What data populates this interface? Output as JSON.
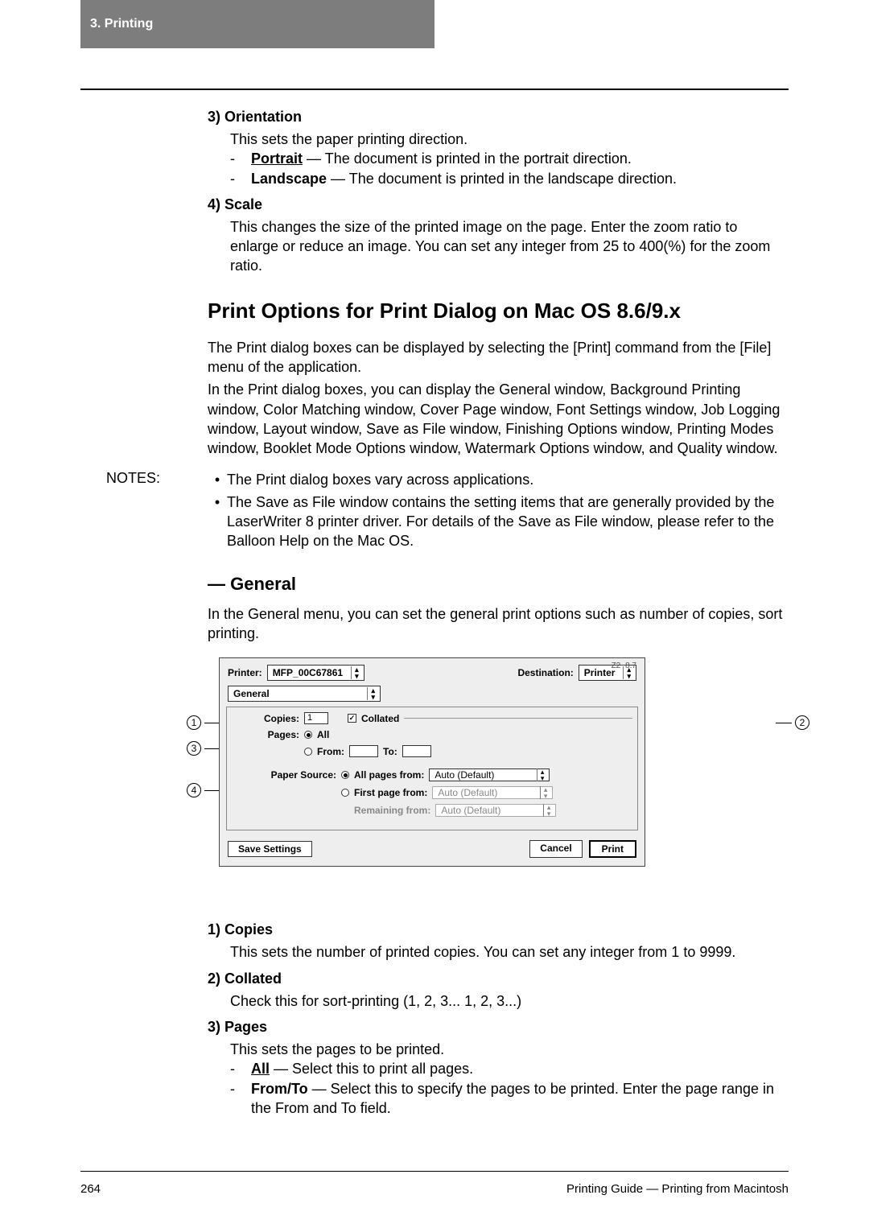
{
  "header": {
    "crumb": "3.  Printing"
  },
  "sec3": {
    "head": "3)  Orientation",
    "line1": "This sets the paper printing direction.",
    "portrait_b": "Portrait",
    "portrait_r": " — The document is printed in the portrait direction.",
    "landscape_b": "Landscape",
    "landscape_r": " — The document is printed in the landscape direction."
  },
  "sec4": {
    "head": "4)  Scale",
    "body": "This changes the size of the printed image on the page.  Enter the zoom ratio to enlarge or reduce an image. You can set any integer from 25 to 400(%) for the zoom ratio."
  },
  "h2": "Print Options for Print Dialog on Mac OS 8.6/9.x",
  "para1": "The Print dialog boxes can be displayed by selecting the [Print] command from the [File] menu of the application.",
  "para2": "In the Print dialog boxes, you can display the General window, Background Printing window, Color Matching window, Cover Page window, Font Settings window, Job Logging window, Layout window, Save as File window, Finishing Options window, Printing Modes window, Booklet Mode Options window, Watermark Options window, and Quality window.",
  "notes": {
    "label": "NOTES:",
    "n1": "The Print dialog boxes vary across applications.",
    "n2": "The Save as File window contains the setting items that are generally provided by the LaserWriter 8 printer driver.  For details of the Save as File window, please refer to the Balloon Help on the Mac OS."
  },
  "h3": "— General",
  "para3": "In the General menu, you can set the general print options such as number of copies, sort printing.",
  "dialog": {
    "ver": "Z2−8.7",
    "printer_l": "Printer:",
    "printer_v": "MFP_00C67861",
    "dest_l": "Destination:",
    "dest_v": "Printer",
    "tab": "General",
    "copies_l": "Copies:",
    "copies_v": "1",
    "collated_l": "Collated",
    "pages_l": "Pages:",
    "all_l": "All",
    "from_l": "From:",
    "to_l": "To:",
    "ps_l": "Paper Source:",
    "allpages_l": "All pages from:",
    "firstpage_l": "First page from:",
    "remaining_l": "Remaining from:",
    "auto": "Auto (Default)",
    "save": "Save Settings",
    "cancel": "Cancel",
    "print": "Print"
  },
  "callouts": {
    "c1": "1",
    "c2": "2",
    "c3": "3",
    "c4": "4"
  },
  "item1": {
    "head": "1)  Copies",
    "body": "This sets the number of printed copies. You can set any integer from 1 to 9999."
  },
  "item2": {
    "head": "2)  Collated",
    "body": "Check this for sort-printing (1, 2, 3... 1, 2, 3...)"
  },
  "item3": {
    "head": "3)  Pages",
    "line1": "This sets the pages to be printed.",
    "all_b": "All",
    "all_r": " — Select this to print all pages.",
    "ft_b": "From/To",
    "ft_r": " — Select this to specify the pages to be printed. Enter the page range in the From and To field."
  },
  "footer": {
    "page": "264",
    "title": "Printing Guide — Printing from Macintosh"
  }
}
